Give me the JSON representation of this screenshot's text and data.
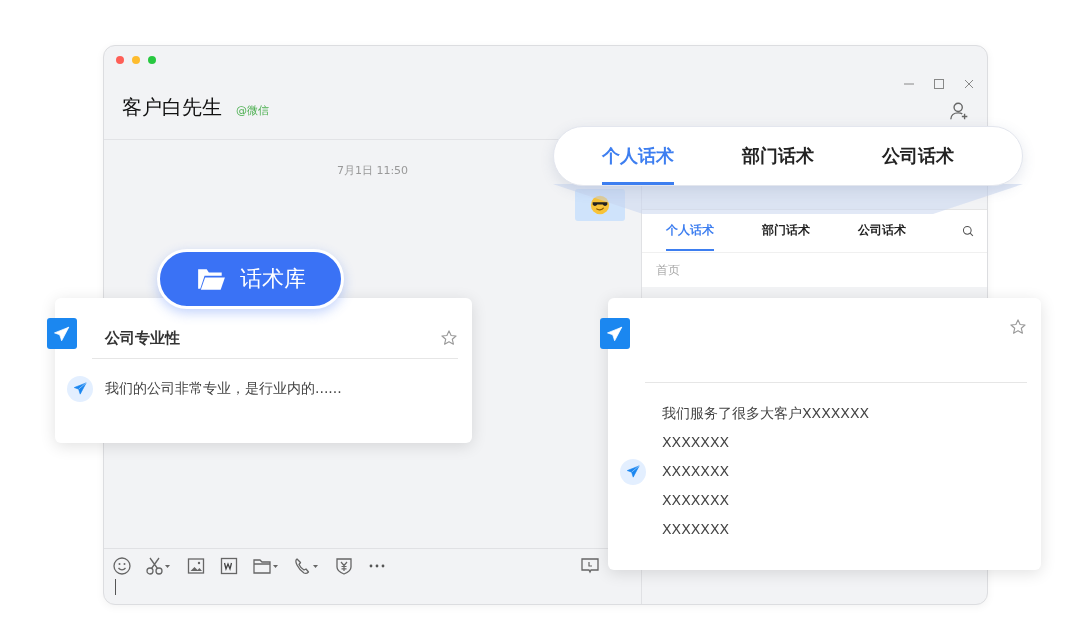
{
  "window": {
    "title": "客户白先生",
    "channel": "@微信"
  },
  "chat": {
    "timestamp": "7月1日 11:50"
  },
  "panel": {
    "tabs": [
      {
        "label": "个人话术",
        "selected": true
      },
      {
        "label": "部门话术",
        "selected": false
      },
      {
        "label": "公司话术",
        "selected": false
      }
    ],
    "breadcrumb": "首页"
  },
  "popup_tabs": [
    {
      "label": "个人话术",
      "selected": true
    },
    {
      "label": "部门话术",
      "selected": false
    },
    {
      "label": "公司话术",
      "selected": false
    }
  ],
  "library_button": {
    "label": "话术库"
  },
  "cards": [
    {
      "title": "公司专业性",
      "lines": [
        "我们的公司非常专业，是行业内的......"
      ]
    },
    {
      "lines": [
        "我们服务了很多大客户XXXXXXX",
        "XXXXXXX",
        "XXXXXXX",
        "XXXXXXX",
        "XXXXXXX"
      ]
    }
  ]
}
